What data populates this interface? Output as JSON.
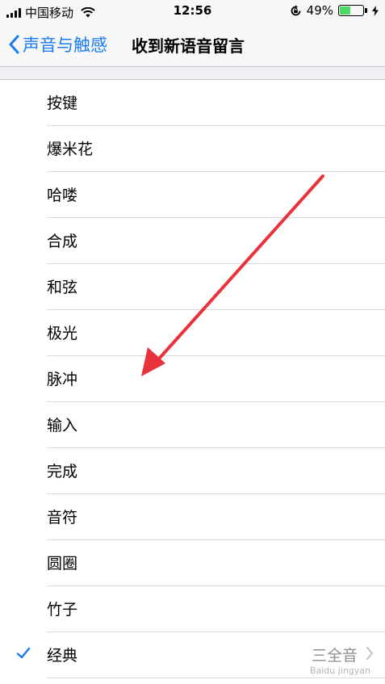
{
  "status_bar": {
    "carrier": "中国移动",
    "time": "12:56",
    "battery_percent": "49%",
    "battery_level": 0.49,
    "icons": [
      "signal-icon",
      "wifi-icon",
      "rotation-lock-icon",
      "battery-icon",
      "charging-icon"
    ]
  },
  "nav": {
    "back_label": "声音与触感",
    "title": "收到新语音留言"
  },
  "list": {
    "items": [
      {
        "label": "按键"
      },
      {
        "label": "爆米花"
      },
      {
        "label": "哈喽"
      },
      {
        "label": "合成"
      },
      {
        "label": "和弦"
      },
      {
        "label": "极光"
      },
      {
        "label": "脉冲"
      },
      {
        "label": "输入"
      },
      {
        "label": "完成"
      },
      {
        "label": "音符"
      },
      {
        "label": "圆圈"
      },
      {
        "label": "竹子"
      },
      {
        "label": "经典",
        "selected": true,
        "detail": "三全音"
      }
    ]
  },
  "colors": {
    "accent": "#1a7cf2",
    "annotation_arrow": "#e8323c",
    "battery_fill": "#4cd964"
  }
}
